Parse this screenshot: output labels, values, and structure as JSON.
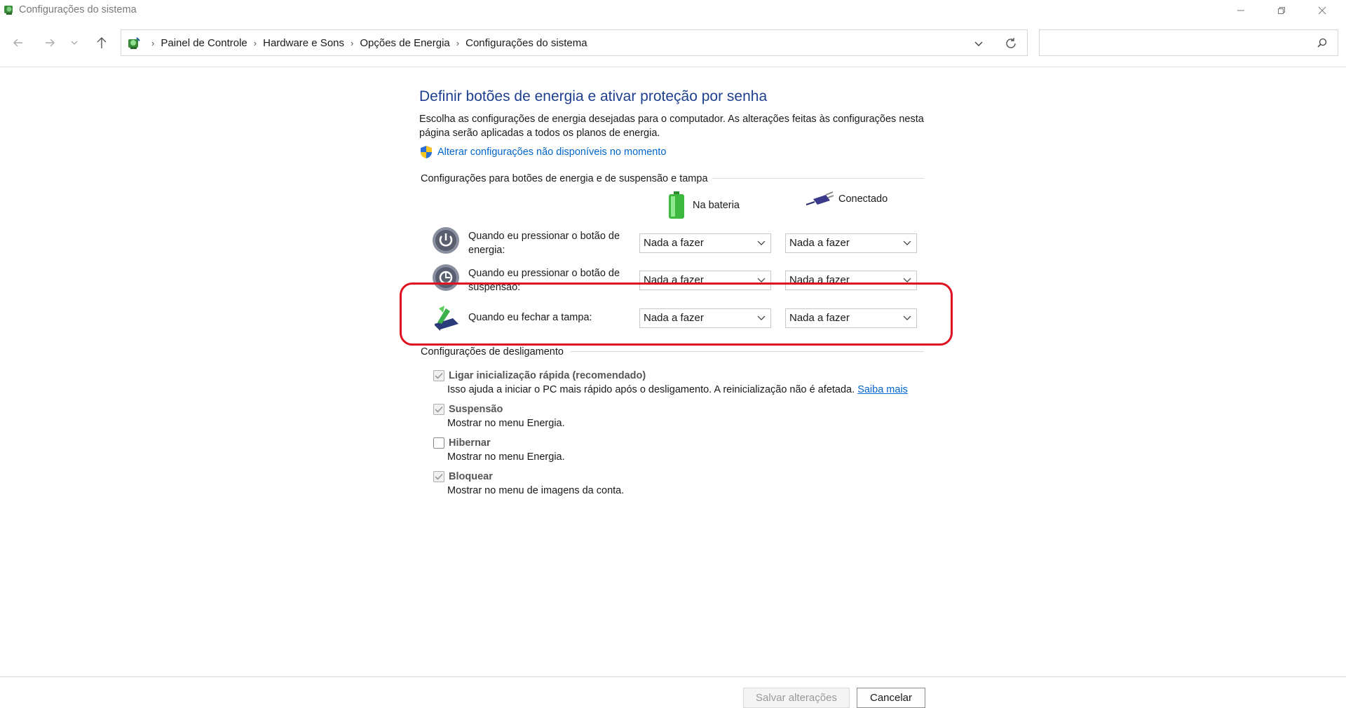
{
  "window": {
    "title": "Configurações do sistema",
    "controls": [
      "minimize-icon",
      "restore-icon",
      "close-icon"
    ]
  },
  "address_bar": {
    "breadcrumbs": [
      "Painel de Controle",
      "Hardware e Sons",
      "Opções de Energia",
      "Configurações do sistema"
    ],
    "search_placeholder": ""
  },
  "main": {
    "title": "Definir botões de energia e ativar proteção por senha",
    "description": "Escolha as configurações de energia desejadas para o computador. As alterações feitas às configurações nesta página serão aplicadas a todos os planos de energia.",
    "uac_link": "Alterar configurações não disponíveis no momento",
    "buttons_section": {
      "heading": "Configurações para botões de energia e de suspensão e tampa",
      "col_battery": "Na bateria",
      "col_plugged": "Conectado",
      "rows": [
        {
          "label": "Quando eu pressionar o botão de energia:",
          "battery": "Nada a fazer",
          "plugged": "Nada a fazer",
          "icon": "power-button-icon"
        },
        {
          "label": "Quando eu pressionar o botão de suspensão:",
          "battery": "Nada a fazer",
          "plugged": "Nada a fazer",
          "icon": "sleep-button-icon"
        },
        {
          "label": "Quando eu fechar a tampa:",
          "battery": "Nada a fazer",
          "plugged": "Nada a fazer",
          "icon": "laptop-lid-icon"
        }
      ]
    },
    "shutdown_section": {
      "heading": "Configurações de desligamento",
      "items": [
        {
          "label": "Ligar inicialização rápida (recomendado)",
          "desc": "Isso ajuda a iniciar o PC mais rápido após o desligamento. A reinicialização não é afetada.",
          "link": "Saiba mais",
          "checked": true,
          "enabled": false
        },
        {
          "label": "Suspensão",
          "desc": "Mostrar no menu Energia.",
          "checked": true,
          "enabled": false
        },
        {
          "label": "Hibernar",
          "desc": "Mostrar no menu Energia.",
          "checked": false,
          "enabled": false
        },
        {
          "label": "Bloquear",
          "desc": "Mostrar no menu de imagens da conta.",
          "checked": true,
          "enabled": false
        }
      ]
    }
  },
  "footer": {
    "save_label": "Salvar alterações",
    "cancel_label": "Cancelar"
  },
  "colors": {
    "title_blue": "#1e3f8f",
    "link_blue": "#0066cc",
    "highlight_red": "#e01020"
  }
}
